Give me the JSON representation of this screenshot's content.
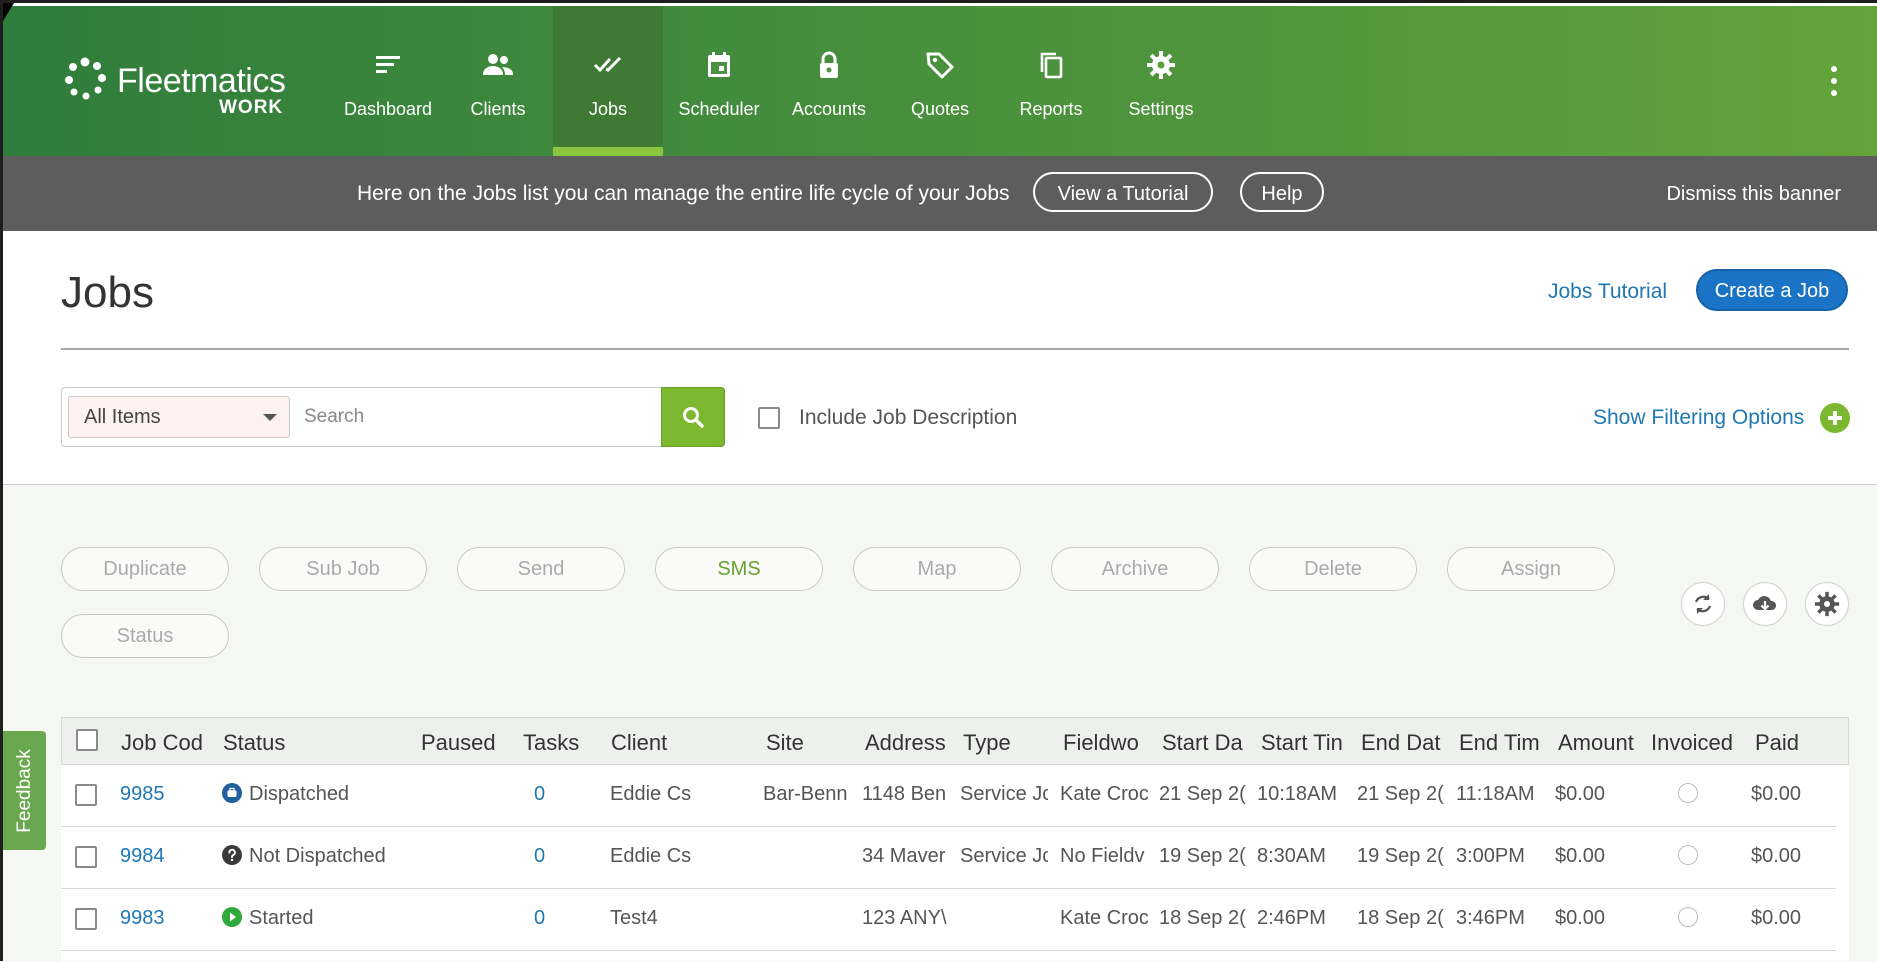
{
  "logo": {
    "brand": "Fleetmatics",
    "product": "WORK"
  },
  "nav": [
    {
      "label": "Dashboard",
      "icon": "dashboard-icon"
    },
    {
      "label": "Clients",
      "icon": "people-icon"
    },
    {
      "label": "Jobs",
      "icon": "double-check-icon",
      "active": true
    },
    {
      "label": "Scheduler",
      "icon": "calendar-icon"
    },
    {
      "label": "Accounts",
      "icon": "lock-icon"
    },
    {
      "label": "Quotes",
      "icon": "tag-icon"
    },
    {
      "label": "Reports",
      "icon": "copy-icon"
    },
    {
      "label": "Settings",
      "icon": "gear-icon"
    }
  ],
  "banner": {
    "message": "Here on the Jobs list you can manage the entire life cycle of your Jobs",
    "tutorial_label": "View a Tutorial",
    "help_label": "Help",
    "dismiss_label": "Dismiss this banner"
  },
  "page": {
    "title": "Jobs",
    "tutorial_link": "Jobs Tutorial",
    "create_label": "Create a Job"
  },
  "search": {
    "scope_value": "All Items",
    "placeholder": "Search",
    "include_description_label": "Include Job Description",
    "show_filters_label": "Show Filtering Options"
  },
  "actions": [
    {
      "label": "Duplicate",
      "enabled": false
    },
    {
      "label": "Sub Job",
      "enabled": false
    },
    {
      "label": "Send",
      "enabled": false
    },
    {
      "label": "SMS",
      "enabled": true
    },
    {
      "label": "Map",
      "enabled": false
    },
    {
      "label": "Archive",
      "enabled": false
    },
    {
      "label": "Delete",
      "enabled": false
    },
    {
      "label": "Assign",
      "enabled": false
    },
    {
      "label": "Status",
      "enabled": false
    }
  ],
  "table": {
    "columns": [
      "Job Cod",
      "Status",
      "Paused",
      "Tasks",
      "Client",
      "Site",
      "Address",
      "Type",
      "Fieldwo",
      "Start Da",
      "Start Tin",
      "End Dat",
      "End Tim",
      "Amount",
      "Invoiced",
      "Paid"
    ],
    "rows": [
      {
        "code": "9985",
        "status": "Dispatched",
        "status_icon": "briefcase-icon",
        "status_color": "#1f5f9e",
        "tasks": "0",
        "client": "Eddie Cs",
        "site": "Bar-Benn",
        "address": "1148 Ben",
        "type": "Service Jc",
        "fieldworker": "Kate Croc",
        "start_date": "21 Sep 2(",
        "start_time": "10:18AM",
        "end_date": "21 Sep 2(",
        "end_time": "11:18AM",
        "amount": "$0.00",
        "paid": "$0.00"
      },
      {
        "code": "9984",
        "status": "Not Dispatched",
        "status_icon": "question-icon",
        "status_color": "#3a3a3a",
        "tasks": "0",
        "client": "Eddie Cs",
        "site": "",
        "address": "34 Maver",
        "type": "Service Jc",
        "fieldworker": "No Fieldv",
        "start_date": "19 Sep 2(",
        "start_time": "8:30AM",
        "end_date": "19 Sep 2(",
        "end_time": "3:00PM",
        "amount": "$0.00",
        "paid": "$0.00"
      },
      {
        "code": "9983",
        "status": "Started",
        "status_icon": "play-icon",
        "status_color": "#2eaa3a",
        "tasks": "0",
        "client": "Test4",
        "site": "",
        "address": "123 ANY\\",
        "type": "",
        "fieldworker": "Kate Croc",
        "start_date": "18 Sep 2(",
        "start_time": "2:46PM",
        "end_date": "18 Sep 2(",
        "end_time": "3:46PM",
        "amount": "$0.00",
        "paid": "$0.00"
      }
    ]
  },
  "feedback_label": "Feedback",
  "colors": {
    "nav_green": "#468e3d",
    "accent_green": "#7cb82f",
    "link_blue": "#1f78b4",
    "primary_blue": "#1a73c4",
    "banner_gray": "#5d5d5d"
  }
}
